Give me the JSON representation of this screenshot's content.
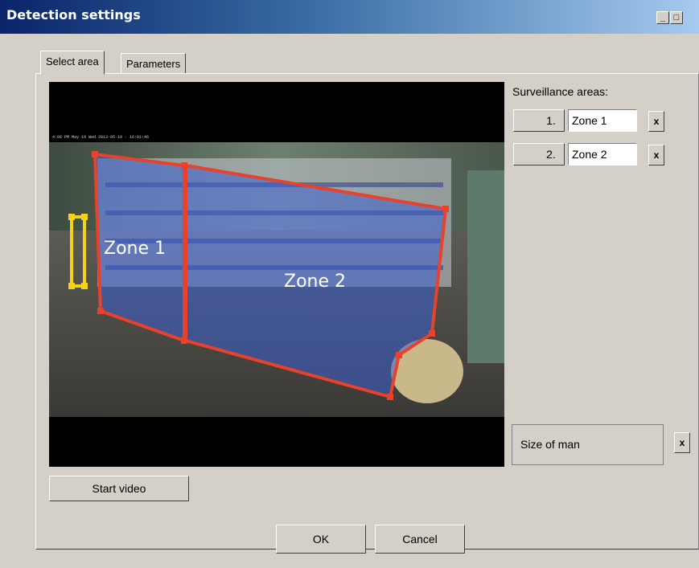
{
  "window": {
    "title": "Detection settings",
    "minimize_glyph": "_",
    "maximize_glyph": "□"
  },
  "tabs": [
    {
      "label": "Select area",
      "active": true
    },
    {
      "label": "Parameters",
      "active": false
    }
  ],
  "video": {
    "overlay_timestamp": "4:00 PM May 19 Wed 2013-05-19 · 16:01:46",
    "zone_1_label": "Zone 1",
    "zone_2_label": "Zone 2",
    "zone_color": "#e8412c",
    "zone_fill": "#3a5fd0",
    "man_marker_color": "#f2d21a"
  },
  "surveillance": {
    "heading": "Surveillance areas:",
    "areas": [
      {
        "index": "1.",
        "value": "Zone 1",
        "delete": "x"
      },
      {
        "index": "2.",
        "value": "Zone 2",
        "delete": "x"
      }
    ]
  },
  "size_of_man": {
    "label": "Size of man",
    "delete": "x"
  },
  "buttons": {
    "start_video": "Start video",
    "ok": "OK",
    "cancel": "Cancel"
  }
}
